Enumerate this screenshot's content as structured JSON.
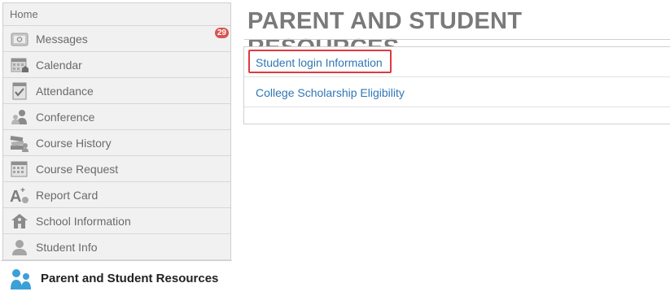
{
  "sidebar": {
    "home_label": "Home",
    "items": [
      {
        "label": "Messages",
        "icon": "envelope-icon",
        "badge": "29"
      },
      {
        "label": "Calendar",
        "icon": "calendar-icon"
      },
      {
        "label": "Attendance",
        "icon": "attendance-checkbox-icon"
      },
      {
        "label": "Conference",
        "icon": "conference-people-icon"
      },
      {
        "label": "Course History",
        "icon": "books-icon"
      },
      {
        "label": "Course Request",
        "icon": "course-request-calendar-icon"
      },
      {
        "label": "Report Card",
        "icon": "report-card-grade-icon"
      },
      {
        "label": "School Information",
        "icon": "school-house-icon"
      },
      {
        "label": "Student Info",
        "icon": "student-person-icon"
      }
    ],
    "active_item": {
      "label": "Parent and Student Resources",
      "icon": "parent-student-people-icon"
    }
  },
  "main": {
    "title": "PARENT AND STUDENT RESOURCES",
    "links": [
      {
        "label": "Student login Information"
      },
      {
        "label": "College Scholarship Eligibility"
      }
    ]
  },
  "colors": {
    "accent_link": "#2f77b5",
    "badge": "#d9534f",
    "highlight": "#e0393e",
    "active_icon": "#3aa0d8"
  }
}
